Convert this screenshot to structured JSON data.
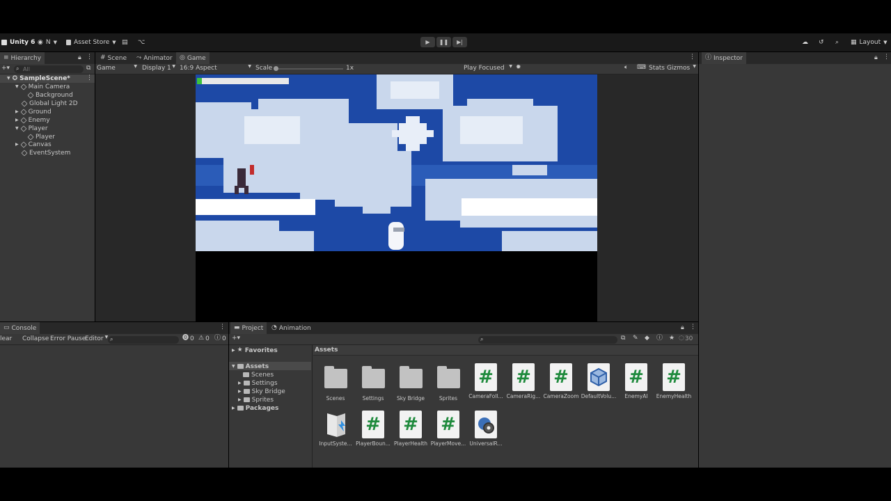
{
  "toolbar": {
    "unity": "Unity 6",
    "account": "N",
    "asset_store": "Asset Store",
    "layout": "Layout"
  },
  "hierarchy": {
    "tab": "Hierarchy",
    "search_placeholder": "All",
    "scene": "SampleScene*",
    "items": [
      "Main Camera",
      "Background",
      "Global Light 2D",
      "Ground",
      "Enemy",
      "Player",
      "Player",
      "Canvas",
      "EventSystem"
    ]
  },
  "gameview": {
    "tabs": [
      "Scene",
      "Animator",
      "Game"
    ],
    "display_mode": "Game",
    "display": "Display 1",
    "aspect": "16:9 Aspect",
    "scale_label": "Scale",
    "scale_value": "1x",
    "play_focused": "Play Focused",
    "stats": "Stats",
    "gizmos": "Gizmos",
    "health_fill": 0.05
  },
  "inspector": {
    "tab": "Inspector"
  },
  "console": {
    "tab": "Console",
    "clear": "lear",
    "collapse": "Collapse",
    "error_pause": "Error Pause",
    "editor": "Editor",
    "errors": "0",
    "warnings": "0",
    "infos": "0"
  },
  "project": {
    "tabs": [
      "Project",
      "Animation"
    ],
    "favorites": "Favorites",
    "assets_root": "Assets",
    "tree": [
      "Scenes",
      "Settings",
      "Sky Bridge",
      "Sprites"
    ],
    "packages": "Packages",
    "breadcrumb": "Assets",
    "hidden_count": "30",
    "assets": [
      {
        "name": "Scenes",
        "type": "folder"
      },
      {
        "name": "Settings",
        "type": "folder"
      },
      {
        "name": "Sky Bridge",
        "type": "folder"
      },
      {
        "name": "Sprites",
        "type": "folder"
      },
      {
        "name": "CameraFoll...",
        "type": "script"
      },
      {
        "name": "CameraRig...",
        "type": "script"
      },
      {
        "name": "CameraZoom",
        "type": "script"
      },
      {
        "name": "DefaultVolu...",
        "type": "volume"
      },
      {
        "name": "EnemyAI",
        "type": "script"
      },
      {
        "name": "EnemyHealth",
        "type": "script"
      },
      {
        "name": "InputSyste...",
        "type": "input"
      },
      {
        "name": "PlayerBoun...",
        "type": "script"
      },
      {
        "name": "PlayerHealth",
        "type": "script"
      },
      {
        "name": "PlayerMove...",
        "type": "script"
      },
      {
        "name": "UniversalR...",
        "type": "settings"
      }
    ]
  },
  "colors": {
    "editor_bg": "#383838",
    "sky": "#1d49a6",
    "cloud": "#c9d7ec",
    "script_hash": "#1e8a3c",
    "health": "#3cc23c"
  }
}
